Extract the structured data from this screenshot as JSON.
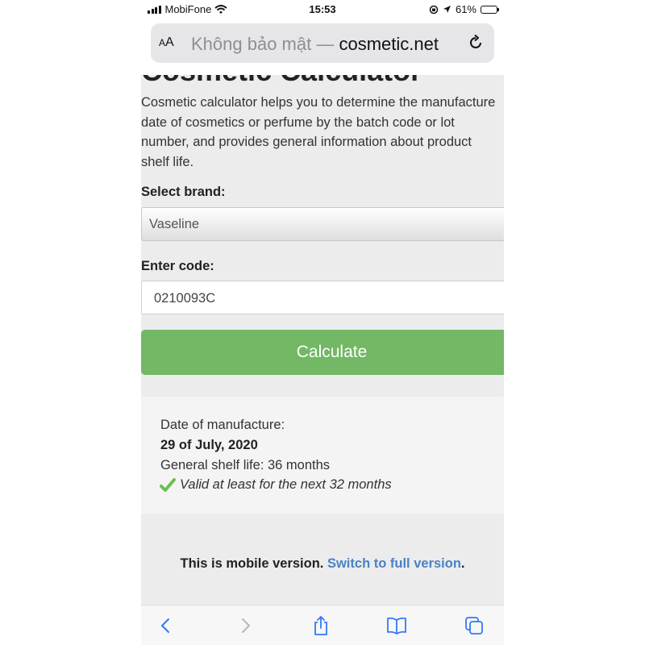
{
  "status_bar": {
    "carrier": "MobiFone",
    "time": "15:53",
    "battery_percent": "61%",
    "battery_level": 0.61
  },
  "url_bar": {
    "text_size_label": "AA",
    "security_text": "Không bảo mật — ",
    "domain": "cosmetic.net"
  },
  "page": {
    "title": "Cosmetic Calculator",
    "intro": "Cosmetic calculator helps you to determine the manufacture\ndate of cosmetics or perfume by the batch code or lot\nnumber, and provides general information about product\nshelf life.",
    "brand_label": "Select brand:",
    "brand_value": "Vaseline",
    "code_label": "Enter code:",
    "code_value": "0210093C",
    "calculate_label": "Calculate",
    "result": {
      "manufacture_label": "Date of manufacture:",
      "manufacture_date": "29 of July, 2020",
      "shelf_life": "General shelf life: 36 months",
      "validity": "Valid at least for the next 32 months"
    },
    "footer_text": "This is mobile version. ",
    "footer_link": "Switch to full version",
    "footer_end": "."
  },
  "colors": {
    "calculate_button": "#72b865",
    "link": "#4a82c4",
    "safari_blue": "#3478f6"
  },
  "toolbar": {
    "icons": [
      "back-icon",
      "forward-icon",
      "share-icon",
      "bookmarks-icon",
      "tabs-icon"
    ]
  }
}
